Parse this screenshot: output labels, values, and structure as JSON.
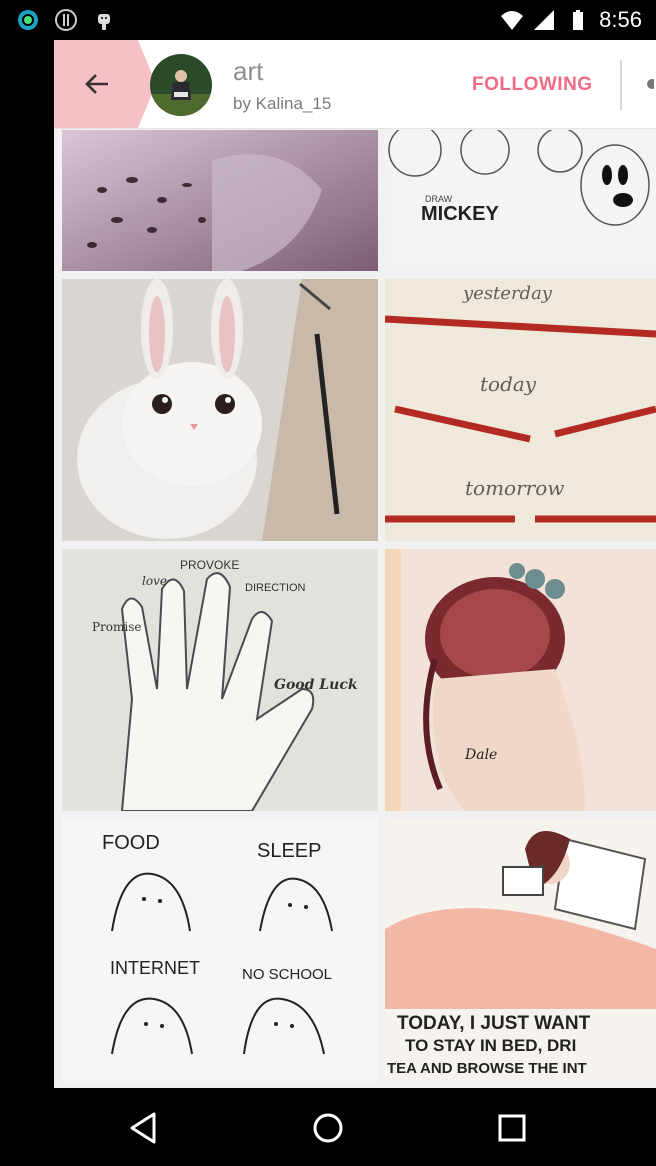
{
  "status_bar": {
    "time": "8:56",
    "icons": [
      "circle-app-icon",
      "info-icon",
      "android-icon",
      "wifi-icon",
      "signal-icon",
      "battery-icon"
    ]
  },
  "header": {
    "title": "art",
    "subtitle": "by Kalina_15",
    "follow_label": "FOLLOWING",
    "accent_color": "#ee6c85",
    "back_tab_color": "#f7bfc6"
  },
  "gallery": {
    "tiles": [
      {
        "name": "sketch-pink-fabric",
        "text": ""
      },
      {
        "name": "mickey-sketch",
        "text": "Draw MICKEY"
      },
      {
        "name": "bunny-drawing",
        "text": ""
      },
      {
        "name": "pencils-drawing",
        "text": [
          "yesterday",
          "today",
          "tomorrow"
        ]
      },
      {
        "name": "hand-drawing",
        "text": [
          "PROVOKE",
          "love",
          "DIRECTION",
          "Promise",
          "Good Luck"
        ]
      },
      {
        "name": "hair-bun-drawing",
        "text": ""
      },
      {
        "name": "ghosts-drawing",
        "text": [
          "FOOD",
          "SLEEP",
          "INTERNET",
          "NO SCHOOL"
        ]
      },
      {
        "name": "bed-drawing",
        "text": [
          "TODAY, I JUST WANT",
          "TO STAY IN BED, DRI",
          "TEA AND BROWSE THE INT"
        ]
      }
    ]
  },
  "nav_bar": {
    "buttons": [
      "back-nav-icon",
      "home-nav-icon",
      "recents-nav-icon"
    ]
  }
}
